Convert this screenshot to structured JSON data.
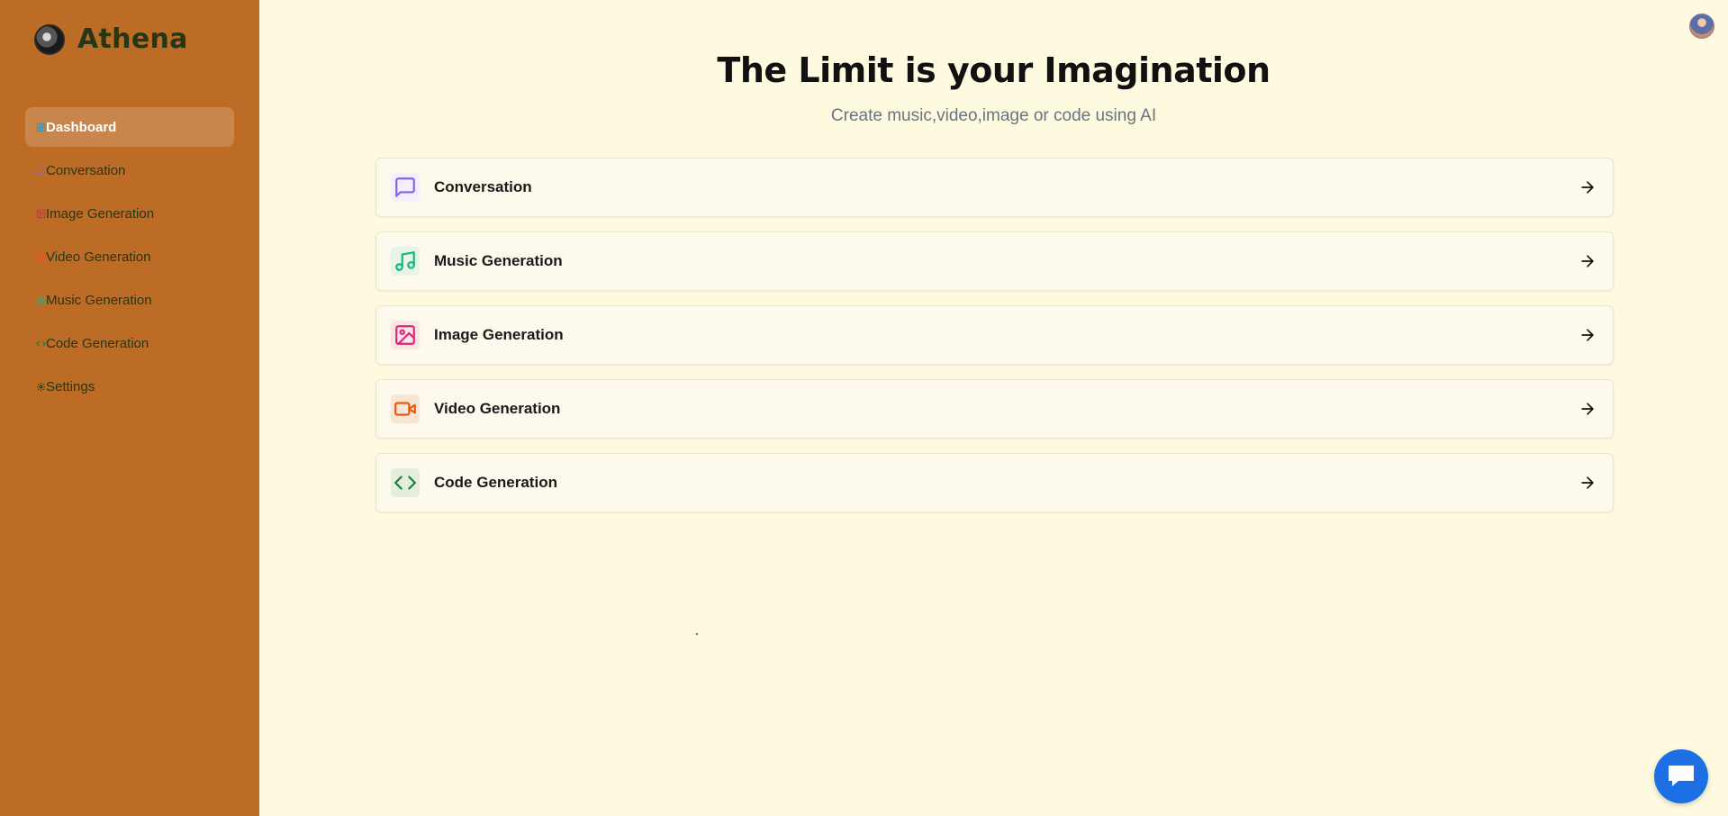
{
  "brand": {
    "name": "Athena"
  },
  "sidebar": {
    "items": [
      {
        "label": "Dashboard",
        "icon": "layout-dashboard-icon",
        "color": "#0ea5e9",
        "active": true
      },
      {
        "label": "Conversation",
        "icon": "message-square-icon",
        "color": "#8b5cf6",
        "active": false
      },
      {
        "label": "Image Generation",
        "icon": "image-icon",
        "color": "#db2777",
        "active": false
      },
      {
        "label": "Video Generation",
        "icon": "video-icon",
        "color": "#ea580c",
        "active": false
      },
      {
        "label": "Music Generation",
        "icon": "music-icon",
        "color": "#10b981",
        "active": false
      },
      {
        "label": "Code Generation",
        "icon": "code-icon",
        "color": "#15803d",
        "active": false
      },
      {
        "label": "Settings",
        "icon": "settings-icon",
        "color": "#283618",
        "active": false
      }
    ]
  },
  "hero": {
    "title": "The Limit is your Imagination",
    "subtitle": "Create music,video,image or code using AI"
  },
  "cards": [
    {
      "label": "Conversation",
      "icon": "message-square-icon",
      "color": "#8b5cf6",
      "bg": "#f3effb"
    },
    {
      "label": "Music Generation",
      "icon": "music-icon",
      "color": "#10b981",
      "bg": "#e9f4e6"
    },
    {
      "label": "Image Generation",
      "icon": "image-icon",
      "color": "#db2777",
      "bg": "#f9e7e6"
    },
    {
      "label": "Video Generation",
      "icon": "video-icon",
      "color": "#ea580c",
      "bg": "#f7e6d6"
    },
    {
      "label": "Code Generation",
      "icon": "code-icon",
      "color": "#15803d",
      "bg": "#e4eedb"
    }
  ],
  "colors": {
    "sidebar_bg": "#bc6c25",
    "page_bg": "#fefae0",
    "brand_text": "#283618",
    "fab": "#1d6fe6"
  }
}
